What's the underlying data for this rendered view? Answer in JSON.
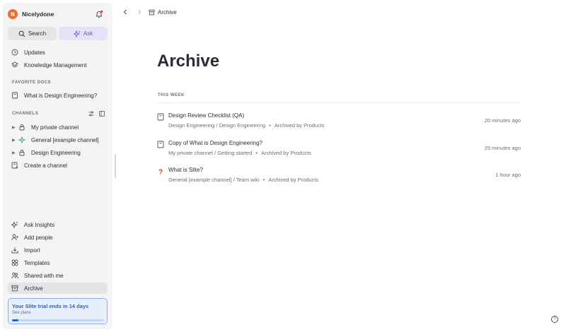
{
  "workspace": {
    "logo_letter": "N",
    "name": "Nicelydone"
  },
  "actions": {
    "search_label": "Search",
    "ask_label": "Ask"
  },
  "nav": {
    "updates": "Updates",
    "knowledge": "Knowledge Management"
  },
  "favorite_docs": {
    "heading": "FAVORITE DOCS",
    "items": [
      "What is Design Engineering?"
    ]
  },
  "channels": {
    "heading": "CHANNELS",
    "items": [
      "My private channel",
      "General [example channel]",
      "Design Engineering"
    ],
    "create_label": "Create a channel"
  },
  "bottom_nav": {
    "ask_insights": "Ask Insights",
    "add_people": "Add people",
    "import": "Import",
    "templates": "Templates",
    "shared": "Shared with me",
    "archive": "Archive"
  },
  "trial": {
    "title": "Your Slite trial ends in 14 days",
    "sub": "See plans",
    "progress": 0.07
  },
  "breadcrumb": {
    "label": "Archive"
  },
  "page": {
    "title": "Archive",
    "section": "THIS WEEK"
  },
  "rows": [
    {
      "title": "Design Review Checklist (QA)",
      "path": "Design Engineering / Design Engineering",
      "archived_by": "Archived by Products",
      "time": "20 minutes ago",
      "icon": "doc-icon"
    },
    {
      "title": "Copy of What is Design Engineering?",
      "path": "My private channel / Getting started",
      "archived_by": "Archived by Products",
      "time": "29 minutes ago",
      "icon": "doc-icon"
    },
    {
      "title": "What is Slite?",
      "path": "General [example channel] / Team wiki",
      "archived_by": "Archived by Products",
      "time": "1 hour ago",
      "icon": "question-icon"
    }
  ],
  "separator": "•",
  "help": "?",
  "colors": {
    "accent": "#6a4fd0",
    "brand": "#f06a2a",
    "trial": "#2d62c9"
  }
}
